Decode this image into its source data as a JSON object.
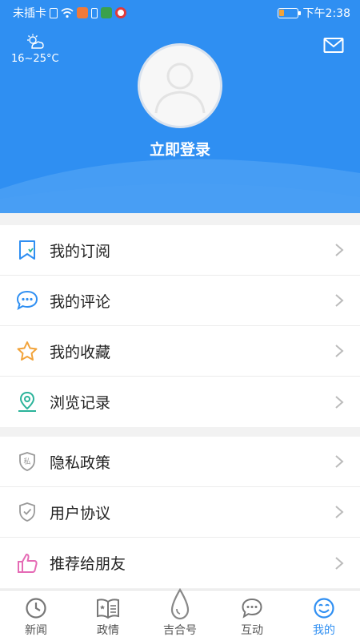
{
  "status_bar": {
    "carrier": "未插卡",
    "time": "下午2:38",
    "battery_level": 0.3,
    "battery_color": "#f2a33a",
    "icons": [
      "sim-icon",
      "wifi-icon",
      "app-notification-icon",
      "battery-saver-icon",
      "app-notification-icon",
      "app-notification-icon"
    ]
  },
  "header": {
    "background_color": "#2f8ff2",
    "weather": {
      "icon": "partly-cloudy-icon",
      "temperature": "16~25°C"
    },
    "mail_icon": "mail-icon",
    "avatar_icon": "default-avatar-icon",
    "login_label": "立即登录"
  },
  "menu": {
    "group1": [
      {
        "label": "我的订阅",
        "icon": "subscription-icon",
        "color": "#2f8ff2"
      },
      {
        "label": "我的评论",
        "icon": "comment-icon",
        "color": "#2f8ff2"
      },
      {
        "label": "我的收藏",
        "icon": "star-icon",
        "color": "#f2a33a"
      },
      {
        "label": "浏览记录",
        "icon": "location-pin-icon",
        "color": "#2bb39a"
      }
    ],
    "group2": [
      {
        "label": "隐私政策",
        "icon": "privacy-shield-icon",
        "badge": "私",
        "color": "#999999"
      },
      {
        "label": "用户协议",
        "icon": "agreement-shield-icon",
        "color": "#999999"
      },
      {
        "label": "推荐给朋友",
        "icon": "thumbs-up-icon",
        "color": "#e56bb5"
      }
    ]
  },
  "tab_bar": {
    "active_color": "#2f8ff2",
    "tabs": [
      {
        "label": "新闻",
        "icon": "clock-icon"
      },
      {
        "label": "政情",
        "icon": "book-icon"
      },
      {
        "label": "吉合号",
        "icon": "drop-icon"
      },
      {
        "label": "互动",
        "icon": "chat-icon"
      },
      {
        "label": "我的",
        "icon": "smiley-icon",
        "active": true
      }
    ]
  }
}
